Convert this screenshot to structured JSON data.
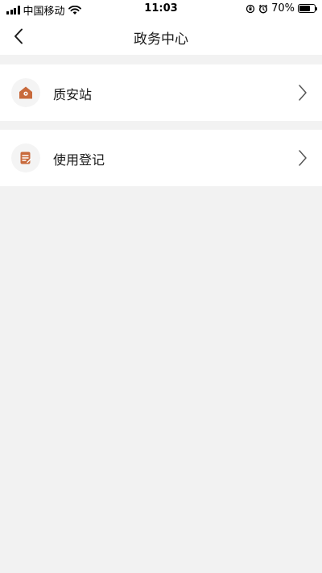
{
  "status_bar": {
    "carrier": "中国移动",
    "time": "11:03",
    "battery": "70%",
    "battery_level": 0.7
  },
  "nav": {
    "title": "政务中心"
  },
  "items": [
    {
      "label": "质安站",
      "icon": "house-icon"
    },
    {
      "label": "使用登记",
      "icon": "document-icon"
    }
  ],
  "colors": {
    "accent": "#c86a3c",
    "background": "#f2f2f2",
    "card": "#ffffff"
  }
}
